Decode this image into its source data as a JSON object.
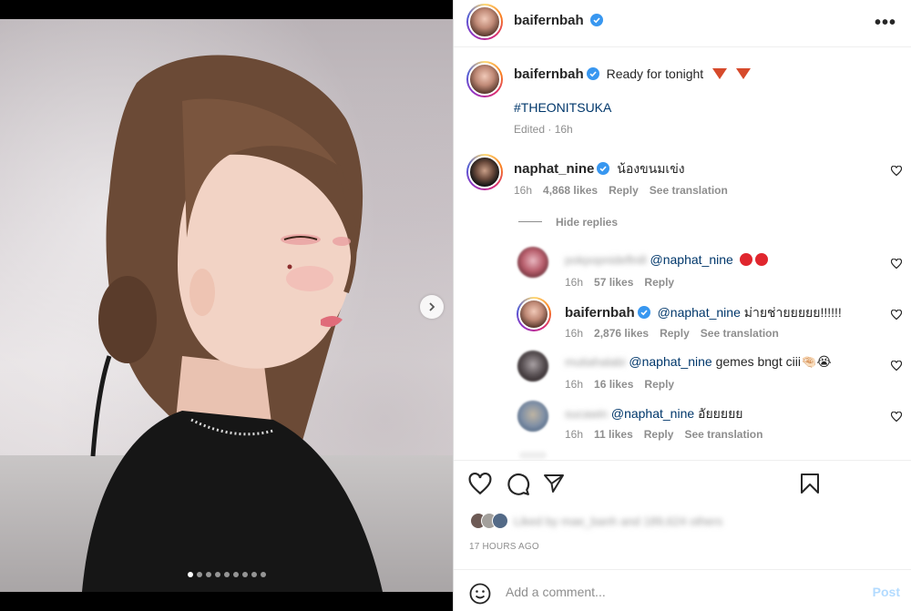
{
  "post": {
    "username": "baifernbah",
    "more": "•••",
    "caption_user": "baifernbah",
    "caption": "Ready for tonight",
    "hashtag": "#THEONITSUKA",
    "edited": "Edited · 16h"
  },
  "comments": [
    {
      "user": "naphat_nine",
      "text": "น้องขนมเข่ง",
      "time": "16h",
      "likes": "4,868 likes",
      "reply": "Reply",
      "translate": "See translation",
      "hide_replies": "Hide replies"
    }
  ],
  "replies": [
    {
      "user": "pokpopnideflnill",
      "mention": "@naphat_nine",
      "text": "",
      "time": "16h",
      "likes": "57 likes",
      "reply": "Reply"
    },
    {
      "user": "baifernbah",
      "mention": "@naphat_nine",
      "text": "ม่ายช่ายยยยย!!!!!!",
      "time": "16h",
      "likes": "2,876 likes",
      "reply": "Reply",
      "translate": "See translation"
    },
    {
      "user": "mutiahalabi",
      "mention": "@naphat_nine",
      "text": "gemes bngt ciii🤏🏻😭",
      "time": "16h",
      "likes": "16 likes",
      "reply": "Reply"
    },
    {
      "user": "sucawin",
      "mention": "@naphat_nine",
      "text": "อัยยยยย",
      "time": "16h",
      "likes": "11 likes",
      "reply": "Reply",
      "translate": "See translation"
    }
  ],
  "liked_by": "Liked by mae_banh and 189,624 others",
  "timestamp": "17 HOURS AGO",
  "comment_box": {
    "placeholder": "Add a comment...",
    "post": "Post"
  },
  "carousel": {
    "slides": 9,
    "active": 0
  },
  "colors": {
    "verified": "#3897f0",
    "link": "#00376b",
    "muted": "#8e8e8e",
    "post_button": "#b3dbff"
  }
}
